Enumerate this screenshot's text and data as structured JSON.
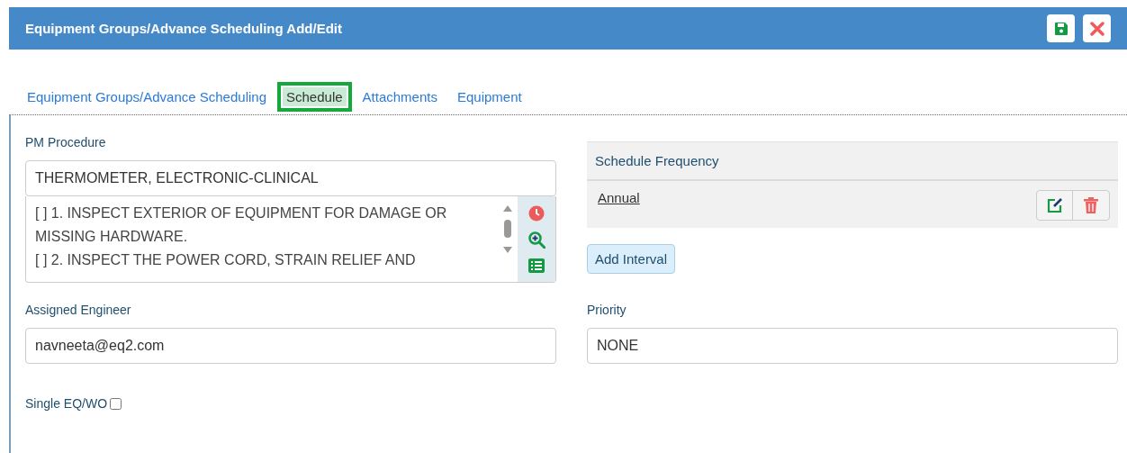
{
  "window": {
    "title": "Equipment Groups/Advance Scheduling Add/Edit"
  },
  "header_buttons": [
    {
      "kind": "save"
    },
    {
      "kind": "close"
    }
  ],
  "tabs": [
    {
      "label": "Equipment Groups/Advance Scheduling",
      "selected": false
    },
    {
      "label": "Schedule",
      "selected": true
    },
    {
      "label": "Attachments",
      "selected": false
    },
    {
      "label": "Equipment",
      "selected": false
    }
  ],
  "pm_procedure": {
    "label": "PM Procedure",
    "value": "THERMOMETER, ELECTRONIC-CLINICAL",
    "steps": [
      "[ ] 1. INSPECT EXTERIOR OF EQUIPMENT FOR DAMAGE OR MISSING HARDWARE.",
      "[ ] 2. INSPECT THE POWER CORD, STRAIN RELIEF AND"
    ],
    "side_buttons": [
      {
        "kind": "clock"
      },
      {
        "kind": "zoom"
      },
      {
        "kind": "list"
      }
    ]
  },
  "schedule_frequency": {
    "heading": "Schedule Frequency",
    "rows": [
      {
        "name": "Annual"
      }
    ],
    "add_button": "Add Interval"
  },
  "assigned_engineer": {
    "label": "Assigned Engineer",
    "value": "navneeta@eq2.com"
  },
  "priority": {
    "label": "Priority",
    "value": "NONE"
  },
  "single_eq_wo": {
    "label": "Single EQ/WO",
    "checked": false
  }
}
